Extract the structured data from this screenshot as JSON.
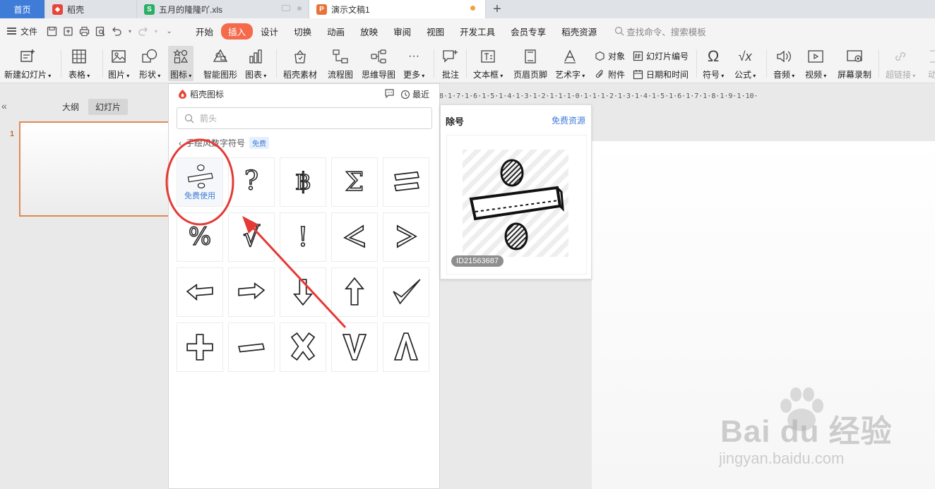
{
  "tabs": [
    {
      "label": "首页"
    },
    {
      "label": "稻壳"
    },
    {
      "label": "五月的隆隆吖.xls"
    },
    {
      "label": "演示文稿1"
    }
  ],
  "add_tab": "+",
  "menubar": {
    "file": "文件",
    "items": [
      "开始",
      "插入",
      "设计",
      "切换",
      "动画",
      "放映",
      "审阅",
      "视图",
      "开发工具",
      "会员专享",
      "稻壳资源"
    ],
    "active": "插入",
    "search_placeholder": "查找命令、搜索模板"
  },
  "ribbon": {
    "new_slide": "新建幻灯片",
    "table": "表格",
    "picture": "图片",
    "shape": "形状",
    "icon": "图标",
    "smart_graphic": "智能图形",
    "chart": "图表",
    "daoke_material": "稻壳素材",
    "flowchart": "流程图",
    "mindmap": "思维导图",
    "more": "更多",
    "comment": "批注",
    "textbox": "文本框",
    "header_footer": "页眉页脚",
    "wordart": "艺术字",
    "object": "对象",
    "attachment": "附件",
    "slide_number": "幻灯片编号",
    "date_time": "日期和时间",
    "symbol": "符号",
    "formula": "公式",
    "audio": "音频",
    "video": "视频",
    "screen_record": "屏幕录制",
    "hyperlink": "超链接",
    "cut_anim": "动"
  },
  "left_panel": {
    "collapse": "«",
    "outline_tab": "大纲",
    "slides_tab": "幻灯片",
    "slide_number": "1"
  },
  "ruler_text": "8·1·7·1·6·1·5·1·4·1·3·1·2·1·1·1·0·1·1·1·2·1·3·1·4·1·5·1·6·1·7·1·8·1·9·1·10·",
  "popup": {
    "title": "稻壳图标",
    "recent": "最近",
    "search_placeholder": "箭头",
    "breadcrumb": "手绘风数字符号",
    "badge": "免费",
    "free_use": "免费使用"
  },
  "icons": [
    "divide-icon",
    "question-icon",
    "baht-icon",
    "sigma-icon",
    "equals-icon",
    "percent-icon",
    "sqrt-icon",
    "exclamation-icon",
    "less-than-icon",
    "greater-than-icon",
    "arrow-left-icon",
    "arrow-right-icon",
    "arrow-down-icon",
    "arrow-up-icon",
    "check-icon",
    "plus-icon",
    "minus-icon",
    "multiply-icon",
    "v-icon",
    "caret-up-icon"
  ],
  "preview": {
    "title": "除号",
    "link": "免费资源",
    "id": "ID21563687"
  },
  "watermark": {
    "brand": "Bai du 经验",
    "url": "jingyan.baidu.com"
  },
  "colors": {
    "accent": "#f46a4b",
    "blue": "#3f7cd8",
    "annotation": "#e53935"
  }
}
